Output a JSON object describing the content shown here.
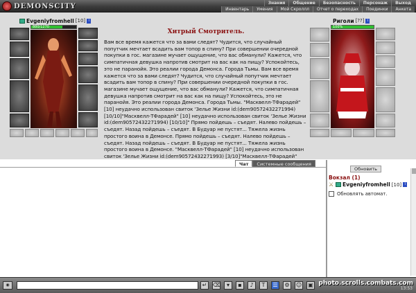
{
  "app": {
    "logo_text": "DEMONSCITY"
  },
  "menu": {
    "row1": [
      "Знания",
      "Общение",
      "Безопасность",
      "Персонаж",
      "Выход"
    ],
    "row2": [
      "Инвентарь",
      "Умения",
      "Мой Скроллл",
      "Отчет о переходах",
      "Поединки",
      "Анкета"
    ]
  },
  "player_left": {
    "name": "Evgeniyfromhell",
    "level": "[10]",
    "info": "i",
    "hp_text": "880/1270",
    "hp_fraction": 0.69
  },
  "player_right": {
    "name": "Риголи",
    "level": "[??]",
    "info": "i",
    "hp_text": "100%",
    "hp_fraction": 1.0
  },
  "story": {
    "title": "Хитрый Смотритель.",
    "text": "Вам все время кажется что за вами следят? Чудится, что случайный попутчик мечтает всадить вам топор в спину? При совершении очередной покупки в гос. магазине мучает ощущение, что вас обманули? Кажется, что симпатичная девушка напротив смотрит на вас как на пищу? Успокойтесь, это не паранойя. Это реалии города Демонса. Города Тьмы. Вам все время кажется что за вами следят? Чудится, что случайный попутчик мечтает всадить вам топор в спину? При совершении очередной покупки в гос. магазине мучает ощущение, что вас обманули? Кажется, что симпатичная девушка напротив смотрит на вас как на пищу? Успокойтесь, это не паранойя. Это реалии города Демонса. Города Тьмы. \"Масквелл-ТФарадей\" [10] неудачно использован свиток 'Зелье Жизни id:(dem90572432271994) [10/10]\"Масквелл-ТФарадей\" [10] неудачно использован свиток 'Зелье Жизни id:(dem90572432271994) [10/10]\" Прямо пойдешь – съедят. Налево пойдешь – съедят. Назад пойдешь – съедят. В Будуар не пустят... Тяжела жизнь простого воина в Демонсе. Прямо пойдешь – съедят. Налево пойдешь – съедят. Назад пойдешь – съедят. В Будуар не пустят... Тяжела жизнь простого воина в Демонсе. \"Масквелл-ТФарадей\" [10] неудачно использован свиток 'Зелье Жизни id:(dem90572432271993) [3/10]\"Масквелл-ТФарадей\" [10] неудачно использован свиток 'Зелье Жизни id:(dem90572432271993) [3/10]\"Злобный Рамзик\" [11] неудачно использован свиток 'Зелье Жизни"
  },
  "tabs": {
    "chat": "Чат",
    "system": "Системные сообщения"
  },
  "room": {
    "refresh_label": "Обновить",
    "location_title": "Вокзал (1)",
    "user_name": "Evgeniyfromhell",
    "user_level": "[10]",
    "user_info": "i",
    "auto_label": "Обновлять автомат."
  },
  "bottom": {
    "watermark": "photo.scrolls.combats.com",
    "clock": "13:53"
  }
}
